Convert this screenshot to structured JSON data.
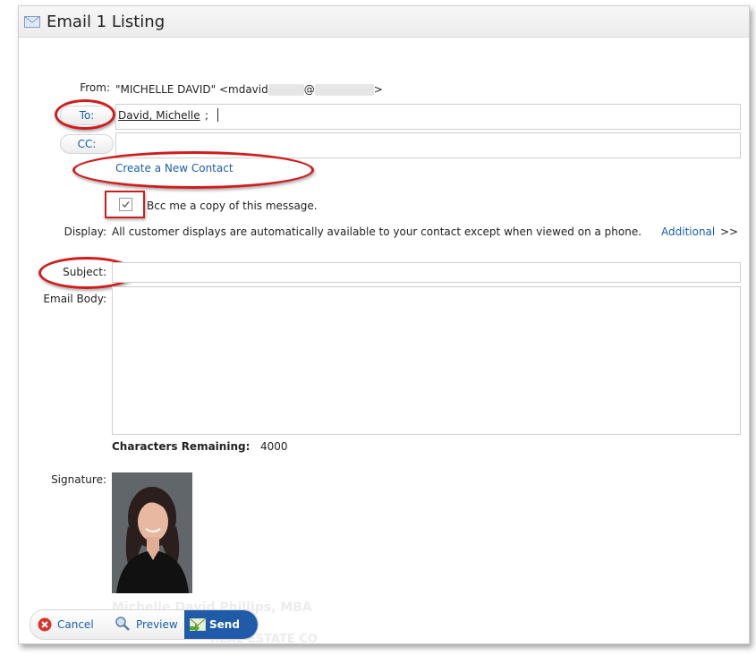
{
  "window": {
    "title": "Email 1 Listing"
  },
  "form": {
    "from_label": "From:",
    "from_value_prefix": "\"MICHELLE DAVID\" <mdavid",
    "from_value_at": "@",
    "from_value_suffix": ">",
    "to_label": "To:",
    "to_value": "David, Michelle",
    "to_separator": ";",
    "cc_label": "CC:",
    "cc_value": "",
    "create_contact_label": "Create a New Contact",
    "bcc_label": "Bcc me a copy of this message.",
    "bcc_checked": true,
    "display_label": "Display:",
    "display_text": "All customer displays are automatically available to your contact except when viewed on a phone.",
    "additional_label": "Additional",
    "additional_chevron": ">>",
    "subject_label": "Subject:",
    "subject_value": "",
    "body_label": "Email Body:",
    "body_value": "",
    "chars_remaining_label": "Characters Remaining:",
    "chars_remaining_value": "4000",
    "signature_label": "Signature:",
    "signature_name": "Michelle David Phillips, MBA",
    "signature_company": "REAL ESTATE CO"
  },
  "buttons": {
    "cancel": "Cancel",
    "preview": "Preview",
    "send": "Send"
  },
  "colors": {
    "link": "#1a5ea8",
    "annotation": "#d11c1c",
    "send_bg": "#1f5ba8"
  },
  "icons": [
    "envelope-icon",
    "cancel-icon",
    "preview-magnifier-icon",
    "send-envelope-icon",
    "checkmark-icon"
  ]
}
